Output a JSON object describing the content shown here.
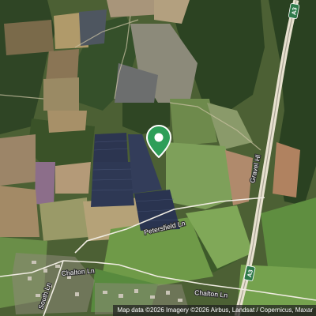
{
  "map": {
    "view": "satellite",
    "marker": {
      "icon": "location-pin-icon",
      "color": "#2e9e58"
    },
    "roads": {
      "a3_top": "A3",
      "a3_bottom": "A3",
      "gravel_hill": "Gravel Hl",
      "petersfield_ln": "Petersfield Ln",
      "chalton_ln_west": "Chalton Ln",
      "chalton_ln_east": "Chalton Ln",
      "south_ln": "South Ln"
    },
    "attribution": "Map data ©2026 Imagery ©2026 Airbus, Landsat / Copernicus, Maxar"
  }
}
